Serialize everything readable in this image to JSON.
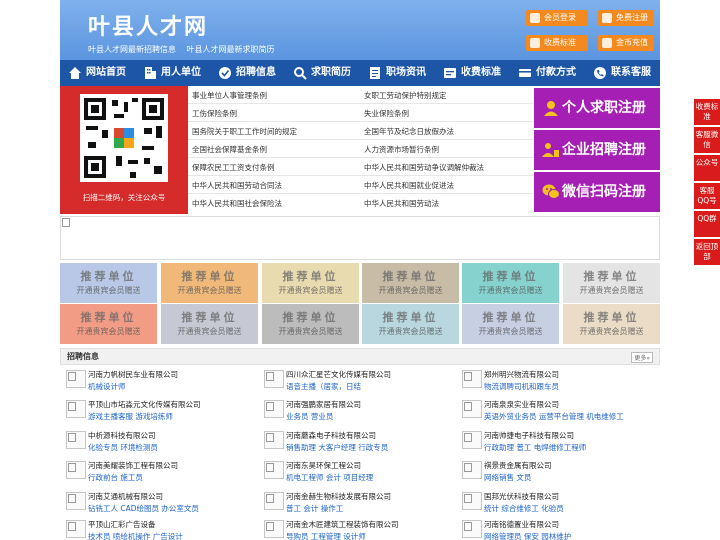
{
  "header": {
    "logo": "叶县人才网",
    "sub_left": "叶县人才网最新招聘信息",
    "sub_right": "叶县人才网最新求职简历",
    "buttons": [
      "会员登录",
      "免费注册",
      "收费标准",
      "金币充值"
    ]
  },
  "nav": {
    "items": [
      "网站首页",
      "用人单位",
      "招聘信息",
      "求职简历",
      "职场资讯",
      "收费标准",
      "付款方式",
      "联系客服"
    ]
  },
  "qr": {
    "caption": "扫描二维码，关注公众号"
  },
  "laws": {
    "left": [
      "事业单位人事管理条例",
      "工伤保险条例",
      "国务院关于职工工作时间的规定",
      "全国社会保障基金条例",
      "保障农民工工资支付条例",
      "中华人民共和国劳动合同法",
      "中华人民共和国社会保险法"
    ],
    "right": [
      "女职工劳动保护特别规定",
      "失业保险条例",
      "全国年节及纪念日放假办法",
      "人力资源市场暂行条例",
      "中华人民共和国劳动争议调解仲裁法",
      "中华人民共和国就业促进法",
      "中华人民共和国劳动法"
    ]
  },
  "register": [
    "个人求职注册",
    "企业招聘注册",
    "微信扫码注册"
  ],
  "recommend": {
    "title": "推荐单位",
    "subtitle": "开通贵宾会员赠送",
    "colors": [
      "#b8c8e6",
      "#f0b97a",
      "#e9dbb0",
      "#c8bca6",
      "#86d2cf",
      "#e4e4e4",
      "#f29c86",
      "#c6c9d3",
      "#bcbcbc",
      "#b9d7df",
      "#c7cfe3",
      "#eadcc6"
    ]
  },
  "jobs": {
    "title": "招聘信息",
    "more": "更多»",
    "list": [
      {
        "company": "河南力帆树民车业有限公司",
        "positions": "机械设计师"
      },
      {
        "company": "四川众汇星芒文化传媒有限公司",
        "positions": "语音主播（居家，日结"
      },
      {
        "company": "郑州明兴物流有限公司",
        "positions": "物流调聘司机和跟车员"
      },
      {
        "company": "平顶山市坧淼元文化传媒有限公司",
        "positions": "游戏主播客服 游戏培练师"
      },
      {
        "company": "河南强鹏家居有限公司",
        "positions": "业务员 营业员"
      },
      {
        "company": "河南泉泉实业有限公司",
        "positions": "英语外贸业务员 运营平台管理 机电维修工"
      },
      {
        "company": "中析源科技有限公司",
        "positions": "化验专员 环境检测员"
      },
      {
        "company": "河南蘑森电子科技有限公司",
        "positions": "销售助理 大客户经理 行政专员"
      },
      {
        "company": "河南帅捷电子科技有限公司",
        "positions": "行政助理 普工 电焊维修工程师"
      },
      {
        "company": "河南美耀装饰工程有限公司",
        "positions": "行政前台 施工员"
      },
      {
        "company": "河南东昊环保工程公司",
        "positions": "机电工程师 会计 项目经理"
      },
      {
        "company": "祺景贵金属有限公司",
        "positions": "网络销售 文员"
      },
      {
        "company": "河南艾通机械有限公司",
        "positions": "钻铣工人 CAD绘图员 办公室文员"
      },
      {
        "company": "河南金赫生物科技发展有限公司",
        "positions": "普工 会计 操作工"
      },
      {
        "company": "国邦光伏科技有限公司",
        "positions": "统计 综合维修工 化验员"
      },
      {
        "company": "平顶山汇彩广告设备",
        "positions": "技术员 喷绘机操作 广告设计"
      },
      {
        "company": "河南金木匠建筑工程装饰有限公司",
        "positions": "导购员 工程管理 设计师"
      },
      {
        "company": "河南铭德置业有限公司",
        "positions": "网络管理员 保安 园林维护"
      }
    ]
  },
  "side": [
    "收费标准",
    "客服微信",
    "公众号",
    "客服QQ号",
    "QQ群",
    "返回顶部"
  ]
}
